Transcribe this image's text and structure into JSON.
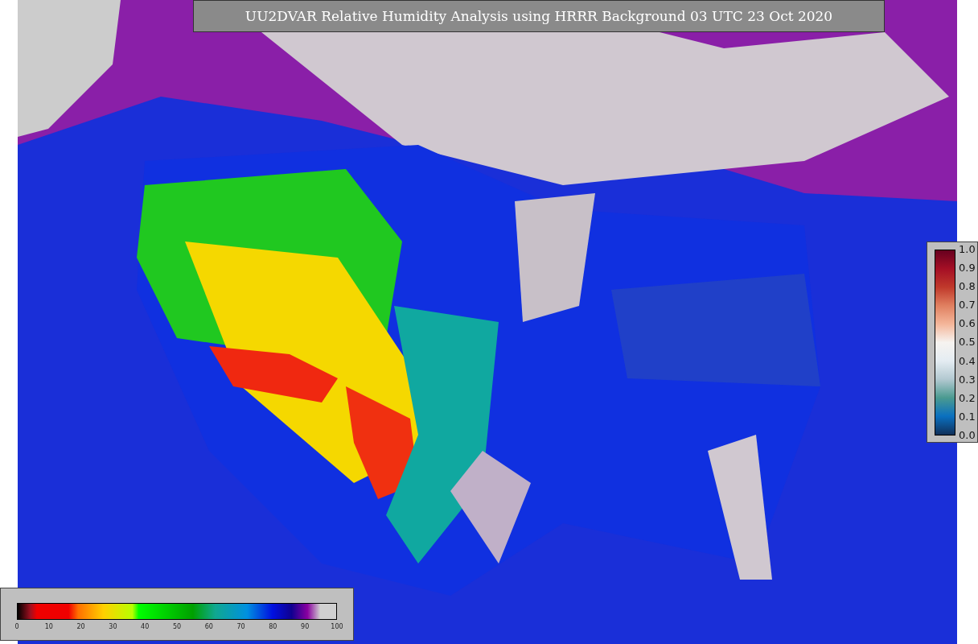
{
  "title": "UU2DVAR Relative Humidity Analysis using HRRR Background 03 UTC 23 Oct 2020",
  "station_scale": {
    "ticks": [
      "1.0",
      "0.9",
      "0.8",
      "0.7",
      "0.6",
      "0.5",
      "0.4",
      "0.3",
      "0.2",
      "0.1",
      "0.0"
    ]
  },
  "humidity_scale": {
    "ticks": [
      "0",
      "10",
      "20",
      "30",
      "40",
      "50",
      "60",
      "70",
      "80",
      "90",
      "100"
    ]
  }
}
